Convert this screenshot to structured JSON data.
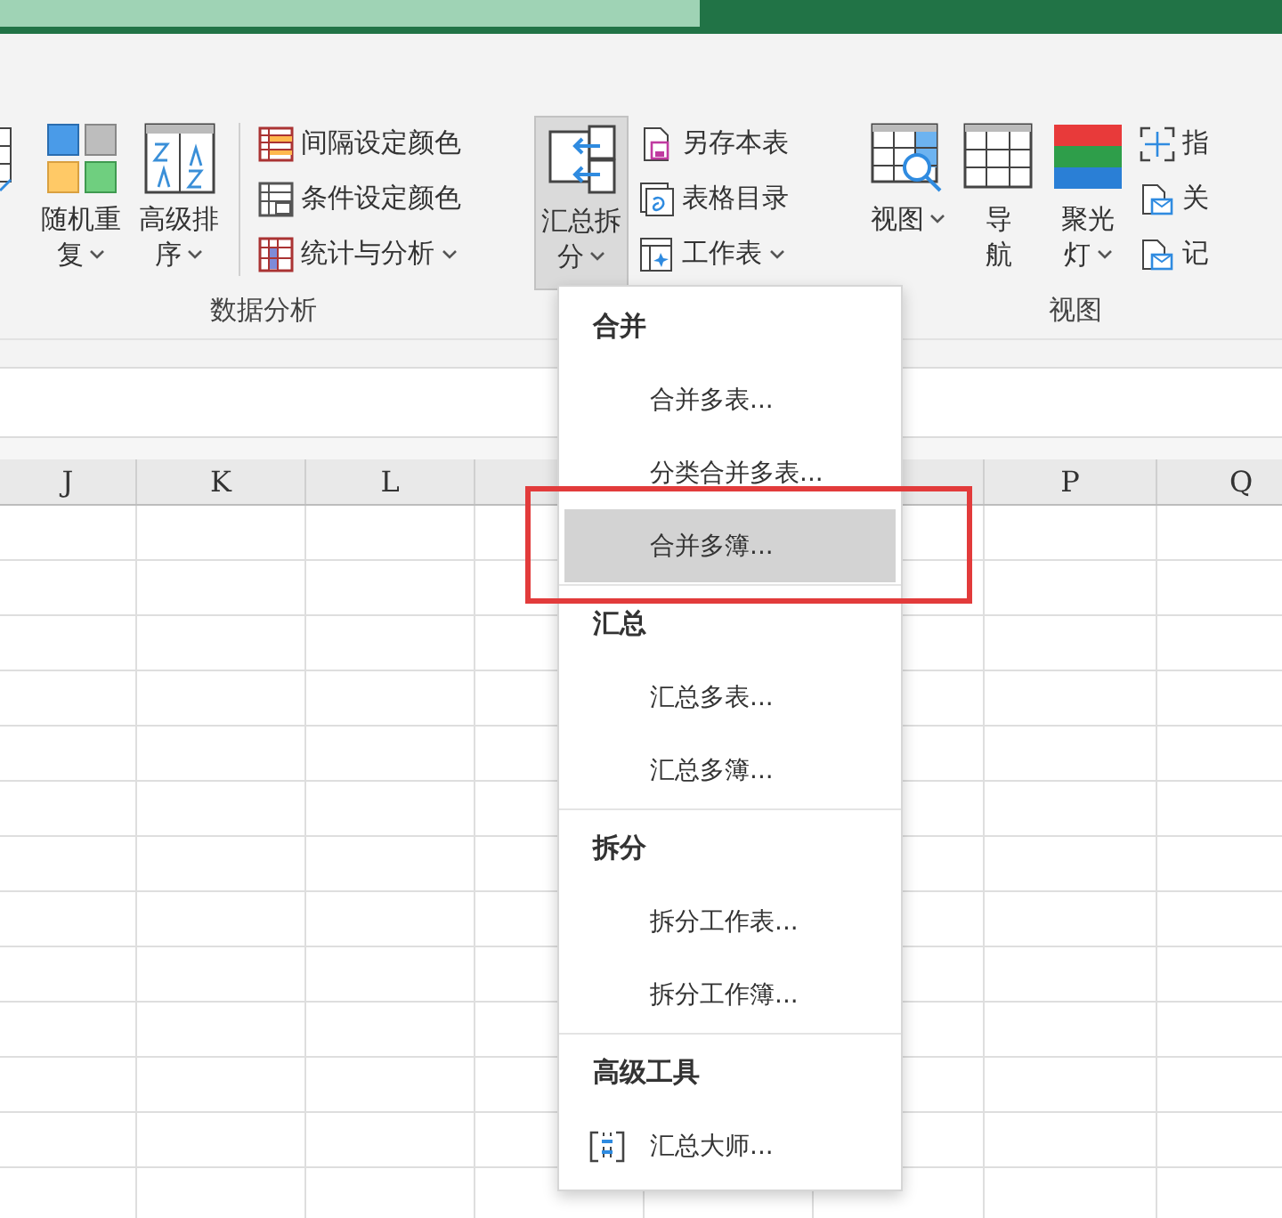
{
  "ribbon": {
    "groups": [
      {
        "items": [
          {
            "kind": "large",
            "lines": [
              "随机重",
              "复"
            ],
            "dropdown": true,
            "selected": false
          },
          {
            "kind": "large",
            "lines": [
              "高级排",
              "序"
            ],
            "dropdown": true,
            "selected": false
          },
          {
            "kind": "small",
            "lines": [
              "间隔设定颜色"
            ],
            "dropdown": false,
            "selected": false
          },
          {
            "kind": "small",
            "lines": [
              "条件设定颜色"
            ],
            "dropdown": false,
            "selected": false
          },
          {
            "kind": "small",
            "lines": [
              "统计与分析"
            ],
            "dropdown": true,
            "selected": false
          }
        ],
        "label": "数据分析"
      },
      {
        "items": [
          {
            "kind": "large",
            "lines": [
              "汇总拆",
              "分"
            ],
            "dropdown": true,
            "selected": true
          },
          {
            "kind": "small",
            "lines": [
              "另存本表"
            ],
            "dropdown": false,
            "selected": false
          },
          {
            "kind": "small",
            "lines": [
              "表格目录"
            ],
            "dropdown": false,
            "selected": false
          },
          {
            "kind": "small",
            "lines": [
              "工作表"
            ],
            "dropdown": true,
            "selected": false
          }
        ]
      },
      {
        "items": [
          {
            "kind": "large",
            "lines": [
              "视图"
            ],
            "dropdown": true,
            "selected": false
          },
          {
            "kind": "large",
            "lines": [
              "导",
              "航"
            ],
            "dropdown": false,
            "selected": false
          },
          {
            "kind": "large",
            "lines": [
              "聚光",
              "灯"
            ],
            "dropdown": true,
            "selected": false
          },
          {
            "kind": "small",
            "lines": [
              "指"
            ],
            "dropdown": false,
            "selected": false
          },
          {
            "kind": "small",
            "lines": [
              "关"
            ],
            "dropdown": false,
            "selected": false
          },
          {
            "kind": "small",
            "lines": [
              "记"
            ],
            "dropdown": false,
            "selected": false
          }
        ],
        "label": "视图"
      }
    ]
  },
  "sheet": {
    "columns": [
      "J",
      "K",
      "L",
      null,
      null,
      null,
      "P",
      "Q"
    ]
  },
  "menu": {
    "sections": [
      {
        "header": "合并",
        "items": [
          {
            "label": "合并多表...",
            "kind": "plain",
            "selected": false
          },
          {
            "label": "分类合并多表...",
            "kind": "plain",
            "selected": false
          },
          {
            "label": "合并多簿...",
            "kind": "plain",
            "selected": true
          }
        ]
      },
      {
        "header": "汇总",
        "items": [
          {
            "label": "汇总多表...",
            "kind": "plain",
            "selected": false
          },
          {
            "label": "汇总多簿...",
            "kind": "plain",
            "selected": false
          }
        ]
      },
      {
        "header": "拆分",
        "items": [
          {
            "label": "拆分工作表...",
            "kind": "plain",
            "selected": false
          },
          {
            "label": "拆分工作簿...",
            "kind": "plain",
            "selected": false
          }
        ]
      },
      {
        "header": "高级工具",
        "items": [
          {
            "label": "汇总大师...",
            "kind": "icon",
            "selected": false
          }
        ]
      }
    ]
  },
  "highlight_frame": true
}
